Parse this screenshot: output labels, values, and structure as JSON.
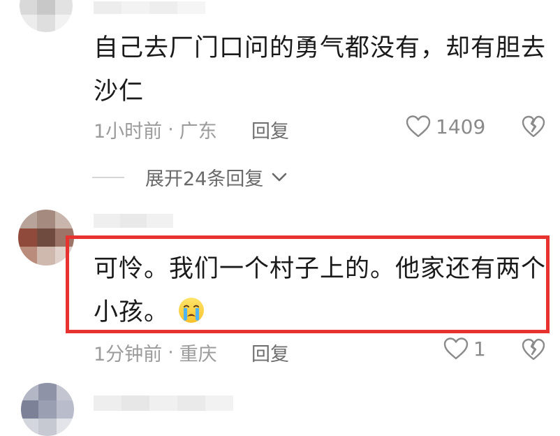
{
  "comments": [
    {
      "text_line1": "自己去厂门口问的勇气都没有，却有胆去",
      "text_line2": "沙仁",
      "time": "1小时前",
      "separator": "·",
      "location": "广东",
      "reply_label": "回复",
      "likes": "1409",
      "expand_label": "展开24条回复"
    },
    {
      "text_line1": "可怜。我们一个村子上的。他家还有两个",
      "text_line2": "小孩。",
      "emoji": "crying-face-emoji",
      "time": "1分钟前",
      "separator": "·",
      "location": "重庆",
      "reply_label": "回复",
      "likes": "1"
    }
  ],
  "colors": {
    "highlight_border": "#e8322f",
    "meta_text": "#9b9b9b",
    "body_text": "#1a1a1a"
  }
}
